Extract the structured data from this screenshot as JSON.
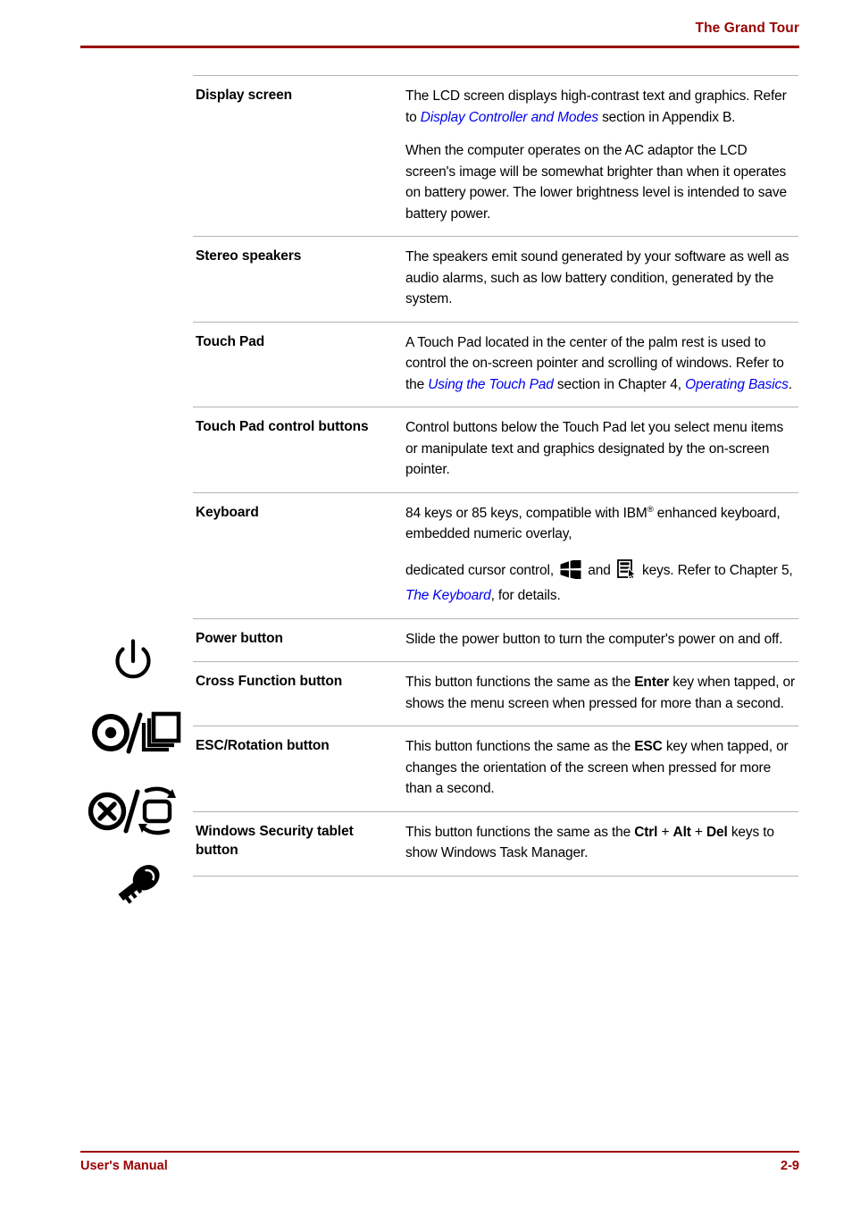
{
  "header": {
    "title": "The Grand Tour",
    "rule_color": "#990000"
  },
  "footer": {
    "left_label": "User's Manual",
    "page_number": "2-9",
    "rule_color": "#990000"
  },
  "colors": {
    "accent_red": "#990000",
    "link_blue": "#0000ee",
    "rule_gray": "#b3b3b3",
    "text_black": "#000000"
  },
  "table": {
    "rows": [
      {
        "icon": null,
        "term": "Display screen",
        "paragraphs": [
          {
            "segments": [
              {
                "text": "The LCD screen displays high-contrast text and graphics. Refer to ",
                "style": "normal"
              },
              {
                "text": "Display Controller and Modes",
                "style": "link"
              },
              {
                "text": " section in Appendix B.",
                "style": "normal"
              }
            ]
          },
          {
            "segments": [
              {
                "text": "When the computer operates on the AC adaptor the LCD screen's image will be somewhat brighter than when it operates on battery power. The lower brightness level is intended to save battery power.",
                "style": "normal"
              }
            ]
          }
        ]
      },
      {
        "icon": null,
        "term": "Stereo speakers",
        "paragraphs": [
          {
            "segments": [
              {
                "text": "The speakers emit sound generated by your software as well as audio alarms, such as low battery condition, generated by the system.",
                "style": "normal"
              }
            ]
          }
        ]
      },
      {
        "icon": null,
        "term": "Touch Pad",
        "paragraphs": [
          {
            "segments": [
              {
                "text": "A Touch Pad located in the center of the palm rest is used to control the on-screen pointer and scrolling of windows. Refer to the ",
                "style": "normal"
              },
              {
                "text": "Using the Touch Pad",
                "style": "link"
              },
              {
                "text": " section in Chapter 4, ",
                "style": "normal"
              },
              {
                "text": "Operating Basics",
                "style": "link"
              },
              {
                "text": ".",
                "style": "normal"
              }
            ]
          }
        ]
      },
      {
        "icon": null,
        "term": "Touch Pad control buttons",
        "paragraphs": [
          {
            "segments": [
              {
                "text": "Control buttons below the Touch Pad let you select menu items or manipulate text and graphics designated by the on-screen pointer.",
                "style": "normal"
              }
            ]
          }
        ]
      },
      {
        "icon": null,
        "term": "Keyboard",
        "paragraphs": [
          {
            "segments": [
              {
                "text": "84 keys or 85 keys, compatible with IBM",
                "style": "normal"
              },
              {
                "text": "®",
                "style": "sup"
              },
              {
                "text": " enhanced keyboard, embedded numeric overlay,",
                "style": "normal"
              }
            ]
          },
          {
            "segments": [
              {
                "text": "dedicated cursor control, ",
                "style": "normal"
              },
              {
                "text": "windows-key-icon",
                "style": "icon"
              },
              {
                "text": " and ",
                "style": "normal"
              },
              {
                "text": "application-key-icon",
                "style": "icon"
              },
              {
                "text": " keys. Refer to Chapter 5, ",
                "style": "normal"
              },
              {
                "text": "The Keyboard",
                "style": "link"
              },
              {
                "text": ", for details.",
                "style": "normal"
              }
            ]
          }
        ]
      },
      {
        "icon": "power-button-icon",
        "term": "Power button",
        "paragraphs": [
          {
            "segments": [
              {
                "text": "Slide the power button to turn the computer's power on and off.",
                "style": "normal"
              }
            ]
          }
        ]
      },
      {
        "icon": "cross-function-button-icon",
        "term": "Cross Function button",
        "paragraphs": [
          {
            "segments": [
              {
                "text": "This button functions the same as the ",
                "style": "normal"
              },
              {
                "text": "Enter",
                "style": "bold"
              },
              {
                "text": " key when tapped, or shows the menu screen when pressed for more than a second.",
                "style": "normal"
              }
            ]
          }
        ]
      },
      {
        "icon": "esc-rotation-button-icon",
        "term": "ESC/Rotation button",
        "paragraphs": [
          {
            "segments": [
              {
                "text": "This button functions the same as the ",
                "style": "normal"
              },
              {
                "text": "ESC",
                "style": "bold"
              },
              {
                "text": " key when tapped, or changes the orientation of the screen when pressed for more than a second.",
                "style": "normal"
              }
            ]
          }
        ]
      },
      {
        "icon": "windows-security-key-icon",
        "term": "Windows Security tablet button",
        "paragraphs": [
          {
            "segments": [
              {
                "text": "This button functions the same as the ",
                "style": "normal"
              },
              {
                "text": "Ctrl",
                "style": "bold"
              },
              {
                "text": " + ",
                "style": "normal"
              },
              {
                "text": "Alt",
                "style": "bold"
              },
              {
                "text": " + ",
                "style": "normal"
              },
              {
                "text": "Del",
                "style": "bold"
              },
              {
                "text": " keys to show Windows Task Manager.",
                "style": "normal"
              }
            ]
          }
        ]
      }
    ]
  }
}
